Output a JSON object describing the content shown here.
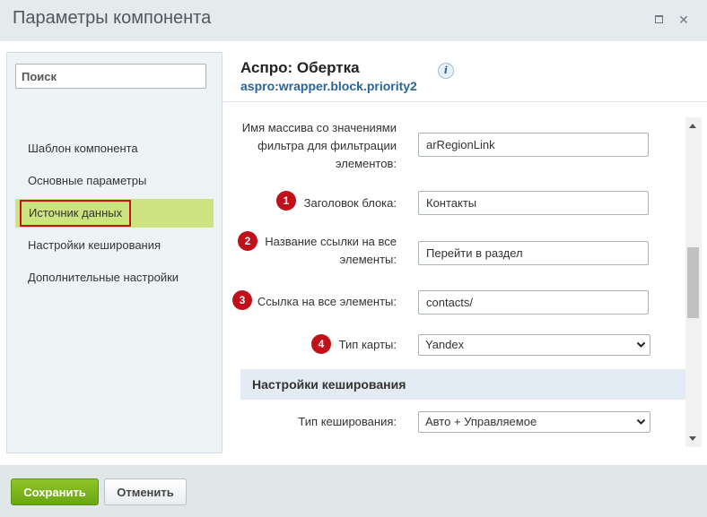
{
  "window": {
    "title": "Параметры компонента"
  },
  "sidebar": {
    "search_placeholder": "Поиск",
    "items": [
      {
        "label": "Шаблон компонента"
      },
      {
        "label": "Основные параметры"
      },
      {
        "label": "Источник данных",
        "active": true
      },
      {
        "label": "Настройки кеширования"
      },
      {
        "label": "Дополнительные настройки"
      }
    ]
  },
  "component": {
    "name": "Аспро: Обертка",
    "code": "aspro:wrapper.block.priority2",
    "info_glyph": "i"
  },
  "fields": {
    "filter_array": {
      "label_lines": [
        "Имя массива со значениями",
        "фильтра для фильтрации",
        "элементов:"
      ],
      "value": "arRegionLink"
    },
    "block_title": {
      "badge": "1",
      "label": "Заголовок блока:",
      "value": "Контакты"
    },
    "all_link_name": {
      "badge": "2",
      "label_lines": [
        "Название ссылки на все",
        "элементы:"
      ],
      "value": "Перейти в раздел"
    },
    "all_link_url": {
      "badge": "3",
      "label": "Ссылка на все элементы:",
      "value": "contacts/"
    },
    "map_type": {
      "badge": "4",
      "label": "Тип карты:",
      "value": "Yandex"
    }
  },
  "cache_section": {
    "title": "Настройки кеширования",
    "cache_type": {
      "label": "Тип кеширования:",
      "value": "Авто + Управляемое"
    }
  },
  "footer": {
    "save_label": "Сохранить",
    "cancel_label": "Отменить"
  },
  "colors": {
    "active_item_bg": "#cce37f",
    "highlight_border": "#c3121a",
    "badge": "#c0101a",
    "save_button": "#79b51b",
    "code_link": "#2a6596"
  }
}
